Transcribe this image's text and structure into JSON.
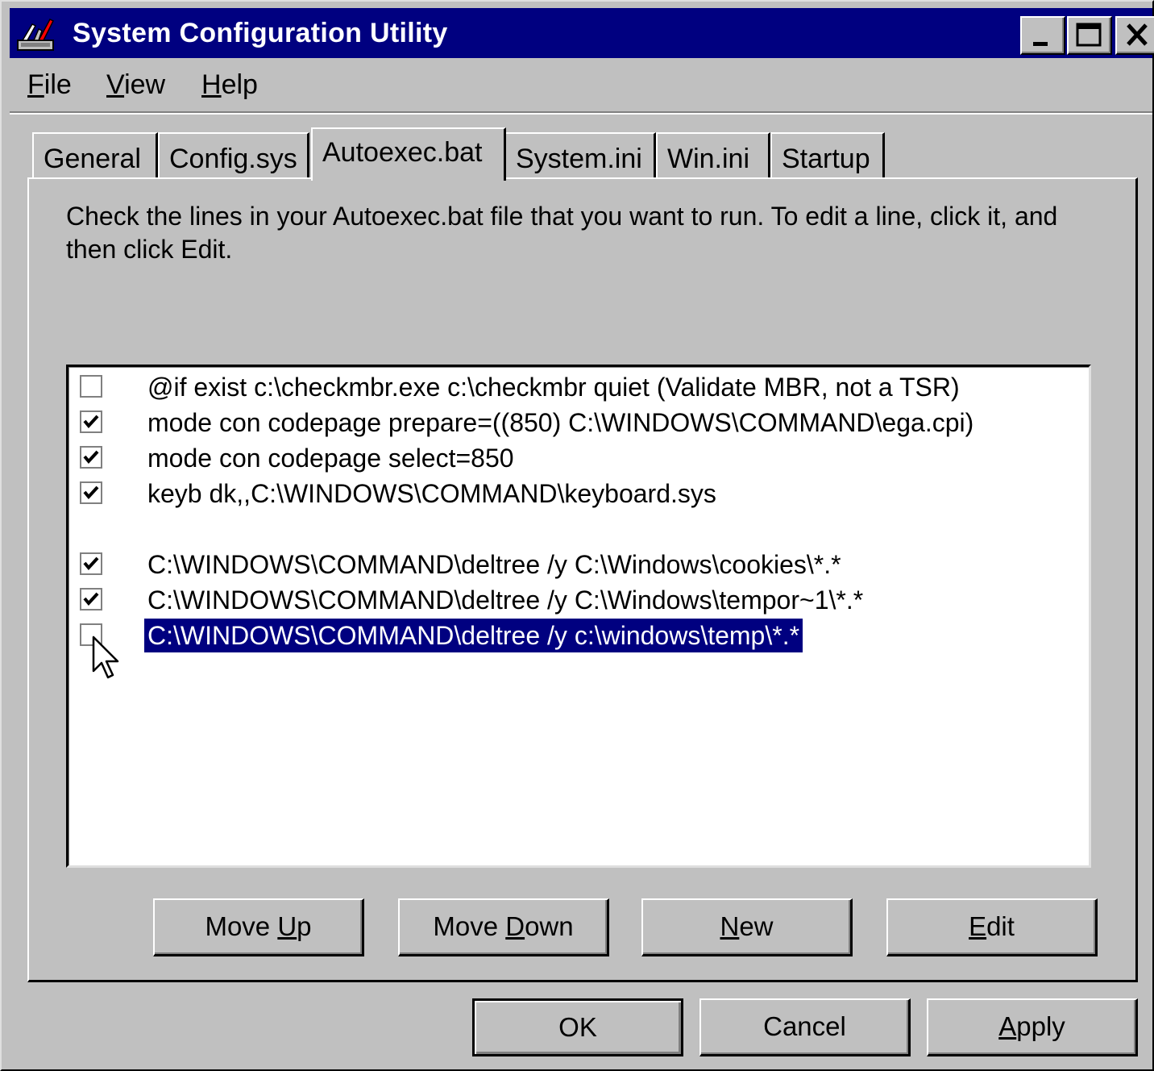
{
  "window": {
    "title": "System Configuration Utility"
  },
  "menu": {
    "items": [
      {
        "label": "File",
        "mnemonic": "F"
      },
      {
        "label": "View",
        "mnemonic": "V"
      },
      {
        "label": "Help",
        "mnemonic": "H"
      }
    ]
  },
  "tabs": [
    {
      "label": "General",
      "active": false
    },
    {
      "label": "Config.sys",
      "active": false
    },
    {
      "label": "Autoexec.bat",
      "active": true
    },
    {
      "label": "System.ini",
      "active": false
    },
    {
      "label": "Win.ini",
      "active": false
    },
    {
      "label": "Startup",
      "active": false
    }
  ],
  "instructions": "Check the lines in your Autoexec.bat file that you want to run. To edit a line, click it, and then click Edit.",
  "autoexec_lines": [
    {
      "text": "@if exist c:\\checkmbr.exe c:\\checkmbr quiet (Validate MBR, not a TSR)",
      "checked": false,
      "selected": false
    },
    {
      "text": "mode con codepage prepare=((850) C:\\WINDOWS\\COMMAND\\ega.cpi)",
      "checked": true,
      "selected": false
    },
    {
      "text": "mode con codepage select=850",
      "checked": true,
      "selected": false
    },
    {
      "text": "keyb dk,,C:\\WINDOWS\\COMMAND\\keyboard.sys",
      "checked": true,
      "selected": false
    },
    {
      "text": "",
      "checked": null,
      "selected": false
    },
    {
      "text": "C:\\WINDOWS\\COMMAND\\deltree /y C:\\Windows\\cookies\\*.*",
      "checked": true,
      "selected": false
    },
    {
      "text": "C:\\WINDOWS\\COMMAND\\deltree /y C:\\Windows\\tempor~1\\*.*",
      "checked": true,
      "selected": false
    },
    {
      "text": "C:\\WINDOWS\\COMMAND\\deltree /y c:\\windows\\temp\\*.*",
      "checked": false,
      "selected": true
    }
  ],
  "list_buttons": {
    "move_up": {
      "label": "Move Up",
      "mnemonic": "U"
    },
    "move_down": {
      "label": "Move Down",
      "mnemonic": "D"
    },
    "new": {
      "label": "New",
      "mnemonic": "N"
    },
    "edit": {
      "label": "Edit",
      "mnemonic": "E"
    }
  },
  "dialog_buttons": {
    "ok": "OK",
    "cancel": "Cancel",
    "apply": {
      "label": "Apply",
      "mnemonic": "A"
    }
  },
  "colors": {
    "titlebar": "#000080",
    "face": "#c0c0c0",
    "selection": "#000080"
  }
}
